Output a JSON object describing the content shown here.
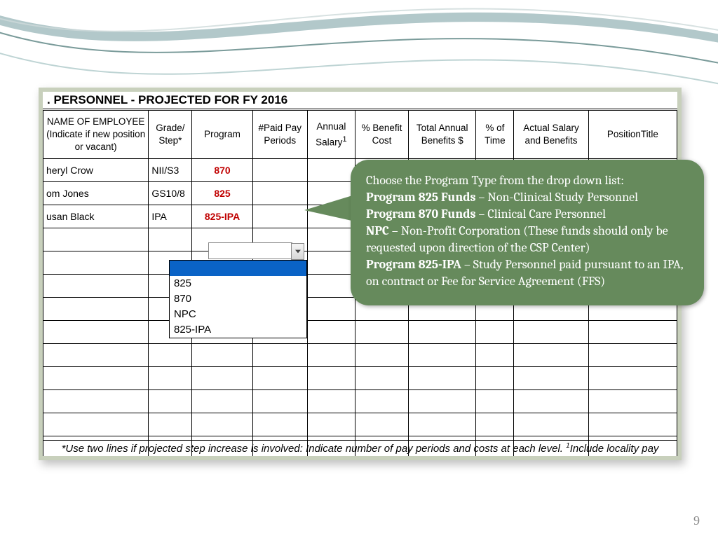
{
  "sheet": {
    "title": ". PERSONNEL - PROJECTED FOR FY 2016",
    "headers": {
      "name": "NAME OF EMPLOYEE (Indicate if new position or vacant)",
      "grade": "Grade/ Step*",
      "program": "Program",
      "ppp": "#Paid Pay Periods",
      "salary_html": "Annual Salary",
      "salary_sup": "1",
      "benefit": "% Benefit Cost",
      "tab": "Total Annual Benefits $",
      "pct": "% of Time",
      "asb": "Actual Salary and Benefits",
      "pt": "PositionTitle"
    },
    "rows": [
      {
        "name": "heryl Crow",
        "grade": "NII/S3",
        "program": "870",
        "tab": "$    -",
        "asb": "$    -"
      },
      {
        "name": "om Jones",
        "grade": "GS10/8",
        "program": "825"
      },
      {
        "name": "usan Black",
        "grade": "IPA",
        "program": "825-IPA"
      }
    ],
    "dropdown": {
      "blank": "",
      "options": [
        "825",
        "870",
        "NPC",
        "825-IPA"
      ]
    },
    "footnote_a": "*Use two lines if projected step increase is involved:  Indicate number of pay periods and costs at each level.  ",
    "footnote_b": "Include locality pay"
  },
  "callout": {
    "intro": "Choose the Program Type from the drop down list:",
    "p825_label": "Program 825 Funds",
    "p825_text": " – Non-Clinical Study Personnel",
    "p870_label": "Program 870 Funds",
    "p870_text": " – Clinical Care Personnel",
    "npc_label": "NPC",
    "npc_text": " – Non-Profit Corporation (These funds should only be requested upon direction of the CSP Center)",
    "ipa_label": "Program 825-IPA",
    "ipa_text": " – Study Personnel paid pursuant to an IPA, on contract or Fee for Service Agreement (FFS)"
  },
  "page_number": "9"
}
